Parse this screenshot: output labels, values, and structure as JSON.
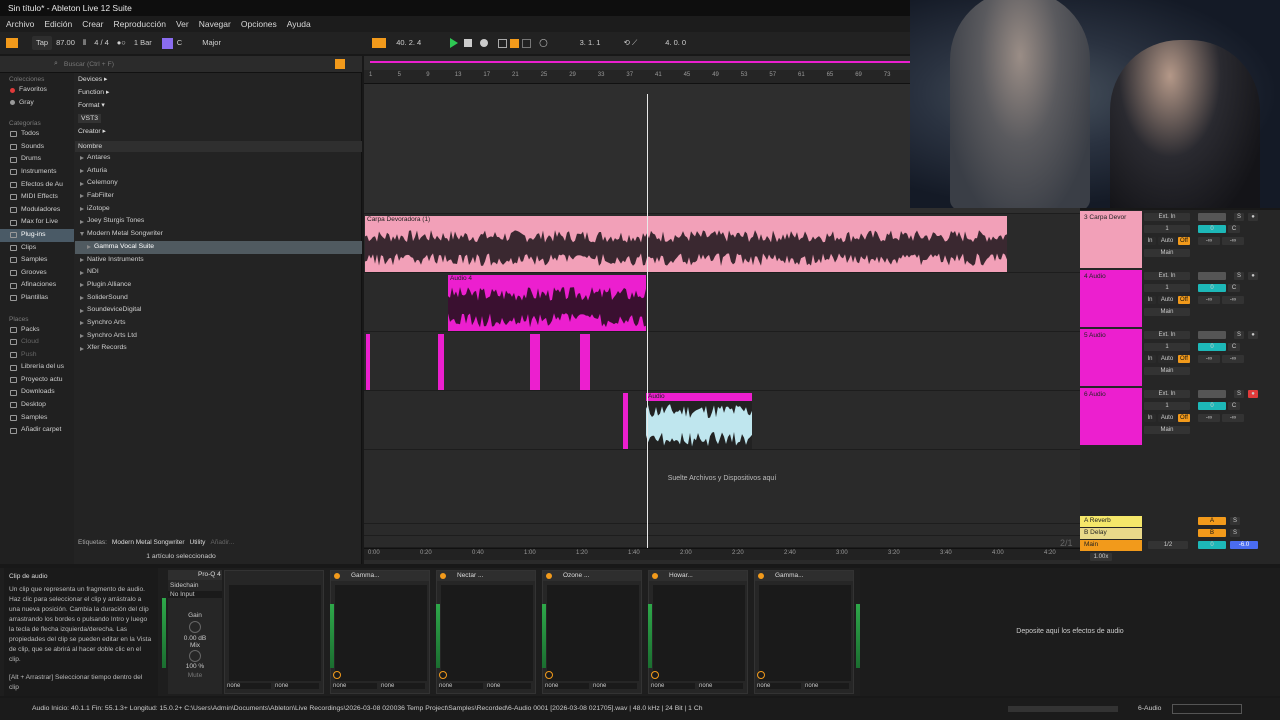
{
  "window": {
    "title": "Sin título* - Ableton Live 12 Suite"
  },
  "menu": [
    "Archivo",
    "Edición",
    "Crear",
    "Reproducción",
    "Ver",
    "Navegar",
    "Opciones",
    "Ayuda"
  ],
  "control": {
    "tap": "Tap",
    "tempo": "87.00",
    "signature": "4 / 4",
    "quantize": "1 Bar",
    "key": "C",
    "scale": "Major",
    "position": "40.  2.  4",
    "loop_start": "3.  1.  1",
    "loop_length": "4.  0.  0"
  },
  "browser": {
    "search_placeholder": "Buscar (Ctrl + F)",
    "collections_label": "Colecciones",
    "collections": [
      "Favoritos",
      "Gray"
    ],
    "categories_label": "Categorías",
    "categories": [
      "Todos",
      "Sounds",
      "Drums",
      "Instruments",
      "Efectos de Au",
      "MIDI Effects",
      "Moduladores",
      "Max for Live",
      "Plug-ins",
      "Clips",
      "Samples",
      "Grooves",
      "Afinaciones",
      "Plantillas"
    ],
    "places_label": "Places",
    "places": [
      "Packs",
      "Cloud",
      "Push",
      "Librería del us",
      "Proyecto actu",
      "Downloads",
      "Desktop",
      "Samples",
      "Añadir carpet"
    ],
    "filters": [
      "Devices ▸",
      "Function ▸",
      "Format ▾",
      "VST3",
      "Creator ▸"
    ],
    "list_header": "Nombre",
    "items": [
      "Antares",
      "Arturia",
      "Celemony",
      "FabFilter",
      "iZotope",
      "Joey Sturgis Tones",
      "Modern Metal Songwriter",
      "Gamma Vocal Suite",
      "Native Instruments",
      "NDI",
      "Plugin Alliance",
      "SoliderSound",
      "SoundeviceDigital",
      "Synchro Arts",
      "Synchro Arts Ltd",
      "Xfer Records"
    ],
    "tags_label": "Etiquetas:",
    "tag1": "Modern Metal Songwriter",
    "tag2": "Utility",
    "tag_add": "Añadir...",
    "status": "1 artículo seleccionado"
  },
  "ruler": [
    "1",
    "5",
    "9",
    "13",
    "17",
    "21",
    "25",
    "29",
    "33",
    "37",
    "41",
    "45",
    "49",
    "53",
    "57",
    "61",
    "65",
    "69",
    "73"
  ],
  "time_ruler": [
    "0:00",
    "0:20",
    "0:40",
    "1:00",
    "1:20",
    "1:40",
    "2:00",
    "2:20",
    "2:40",
    "3:00",
    "3:20",
    "3:40",
    "4:00",
    "4:20"
  ],
  "tracks": [
    {
      "name": "3 Carpa Devor",
      "clip": "Carpa Devoradora (1)",
      "color": "#f2a0b8"
    },
    {
      "name": "4 Audio",
      "clip": "Audio 4",
      "color": "#ec1fcf"
    },
    {
      "name": "5 Audio",
      "clip": "Audio",
      "color": "#ec1fcf"
    },
    {
      "name": "6 Audio",
      "clip": "Audio",
      "color": "#ec1fcf"
    }
  ],
  "drop_hint": "Suelte Archivos y Dispositivos aquí",
  "returns": [
    {
      "name": "A Reverb",
      "send": "A"
    },
    {
      "name": "B Delay",
      "send": "B"
    }
  ],
  "master": {
    "name": "Main",
    "ratio": "1/2",
    "vol": "0",
    "extra": "-6.0"
  },
  "mix": {
    "input": "Ext. In",
    "ch": "1",
    "in": "In",
    "auto": "Auto",
    "off": "Off",
    "out": "Main",
    "vol": "0",
    "pan": "C",
    "inf": "-∞"
  },
  "page_indicator": "2/1",
  "zoom": "1.00x",
  "info": {
    "title": "Clip de audio",
    "body": "Un clip que representa un fragmento de audio. Haz clic para seleccionar el clip y arrástralo a una nueva posición. Cambia la duración del clip arrastrando los bordes o pulsando Intro y luego la tecla de flecha izquierda/derecha. Las propiedades del clip se pueden editar en la Vista de clip, que se abrirá al hacer doble clic en el clip.",
    "hint": "[Alt + Arrastrar] Seleccionar tiempo dentro del clip"
  },
  "sidechain": {
    "label": "Sidechain",
    "input": "No Input",
    "gain": "Gain",
    "gain_val": "0.00 dB",
    "mix": "Mix",
    "mix_val": "100 %",
    "mute": "Mute"
  },
  "devices": [
    "Pro-Q 4",
    "Gamma...",
    "Nectar ...",
    "Ozone ...",
    "Howar...",
    "Gamma..."
  ],
  "none": "none",
  "drop_fx": "Deposite aquí los efectos de audio",
  "status": {
    "text": "Audio Inicio: 40.1.1  Fin: 55.1.3+  Longitud: 15.0.2+  C:\\Users\\Admin\\Documents\\Ableton\\Live Recordings\\2026-03-08 020036 Temp Project\\Samples\\Recorded\\6-Audio 0001 [2026-03-08 021705].wav | 48.0 kHz | 24 Bit | 1 Ch",
    "track": "6-Audio"
  }
}
